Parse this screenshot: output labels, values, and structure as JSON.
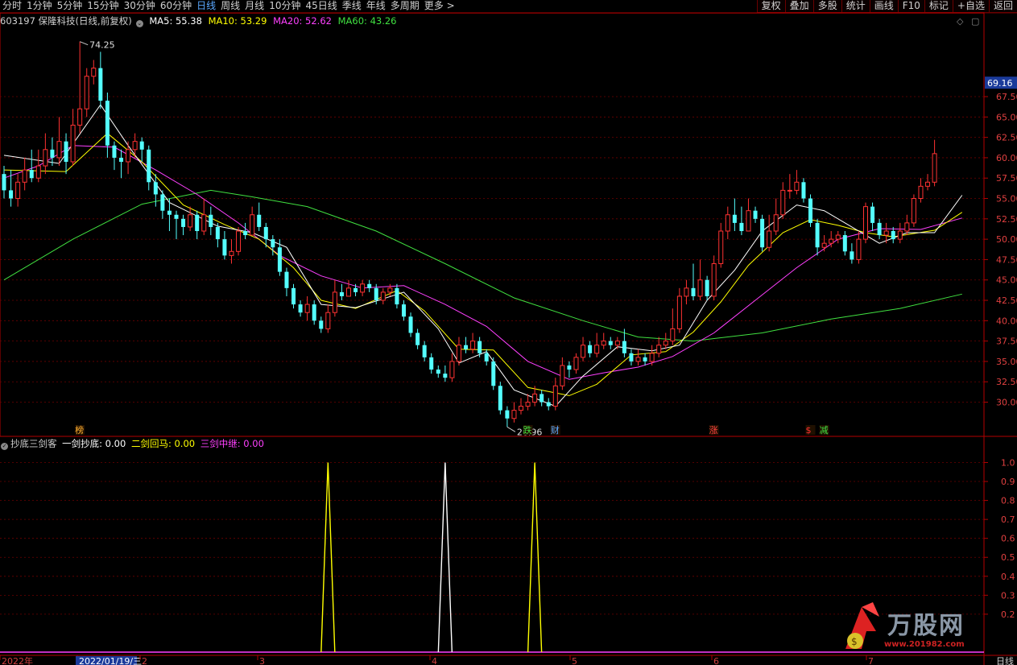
{
  "toolbar": {
    "periods": [
      "分时",
      "1分钟",
      "5分钟",
      "15分钟",
      "30分钟",
      "60分钟",
      "日线",
      "周线",
      "月线",
      "10分钟",
      "45日线",
      "季线",
      "年线",
      "多周期",
      "更多 >"
    ],
    "active_period": "日线",
    "tools": [
      "复权",
      "叠加",
      "多股",
      "统计",
      "画线",
      "F10",
      "标记",
      "+自选",
      "返回"
    ]
  },
  "info": {
    "stock": "603197 保隆科技(日线,前复权)",
    "ma5": "MA5: 55.38",
    "ma10": "MA10: 53.29",
    "ma20": "MA20: 52.62",
    "ma60": "MA60: 43.26"
  },
  "indicator": {
    "name": "抄底三剑客",
    "line1": "一剑抄底: 0.00",
    "line2": "二剑回马: 0.00",
    "line3": "三剑中继: 0.00"
  },
  "colors": {
    "up": "#ff3232",
    "down": "#54ffff",
    "ma5": "#ffffff",
    "ma10": "#ffff00",
    "ma20": "#ff40ff",
    "ma60": "#40e040",
    "axis": "#b40000",
    "grid": "#6e0000"
  },
  "chart_data": [
    {
      "type": "candlestick",
      "title": "",
      "ylim": [
        26.0,
        76.0
      ],
      "y_ticks": [
        "30.00",
        "32.50",
        "35.00",
        "37.50",
        "40.00",
        "42.50",
        "45.00",
        "47.50",
        "50.00",
        "52.50",
        "55.00",
        "57.50",
        "60.00",
        "62.50",
        "65.00",
        "67.50"
      ],
      "price_label": "69.16",
      "high_label": "74.25",
      "low_label": "26.96",
      "x_labels": [
        "2022年",
        "2022/01/19/三",
        "2",
        "3",
        "4",
        "5",
        "6",
        "7",
        "日线"
      ],
      "event_markers": [
        "榜",
        "跌",
        "财",
        "涨",
        "$",
        "减"
      ],
      "candles": [
        [
          58.0,
          56,
          59,
          55
        ],
        [
          56,
          55,
          58.5,
          54
        ],
        [
          55,
          57,
          58,
          54
        ],
        [
          57,
          58.5,
          60,
          56
        ],
        [
          58.5,
          57.5,
          61,
          57
        ],
        [
          57.5,
          59,
          61,
          57
        ],
        [
          59,
          61,
          63,
          58
        ],
        [
          61,
          60,
          62.5,
          59
        ],
        [
          60,
          62,
          65,
          59
        ],
        [
          62,
          59.5,
          63,
          58
        ],
        [
          59.5,
          64,
          66,
          59
        ],
        [
          64,
          66,
          74.25,
          63
        ],
        [
          66,
          70,
          71,
          65
        ],
        [
          70,
          71,
          72,
          69
        ],
        [
          71,
          67,
          73,
          66
        ],
        [
          67,
          61.5,
          68,
          60
        ],
        [
          61.5,
          60,
          62,
          58.5
        ],
        [
          60,
          59.5,
          61,
          57.5
        ],
        [
          59.5,
          61,
          62,
          58
        ],
        [
          61,
          62,
          63,
          60
        ],
        [
          62,
          61,
          62.5,
          59.5
        ],
        [
          61,
          57,
          61.5,
          56
        ],
        [
          57,
          55.5,
          58,
          54
        ],
        [
          55.5,
          53.5,
          56,
          52.5
        ],
        [
          53.5,
          53,
          55,
          51
        ],
        [
          53,
          52.5,
          53.5,
          50
        ],
        [
          52.5,
          51.5,
          53,
          50.5
        ],
        [
          51.5,
          53,
          54,
          51
        ],
        [
          53,
          51,
          53.5,
          50
        ],
        [
          51,
          53,
          55,
          50.5
        ],
        [
          53,
          51.5,
          54,
          50.5
        ],
        [
          51.5,
          50,
          52,
          49
        ],
        [
          50,
          48,
          51,
          47.5
        ],
        [
          48,
          48.5,
          50,
          47
        ],
        [
          48.5,
          51,
          51.5,
          48
        ],
        [
          51,
          50.5,
          52,
          50
        ],
        [
          50.5,
          53,
          54,
          50.5
        ],
        [
          53,
          51.5,
          54.5,
          51
        ],
        [
          51.5,
          50,
          52,
          49
        ],
        [
          50,
          49,
          50.5,
          48
        ],
        [
          49,
          46,
          50,
          45.5
        ],
        [
          46,
          44,
          46.5,
          43
        ],
        [
          44,
          42,
          44.5,
          41.5
        ],
        [
          42,
          41,
          42.5,
          40.5
        ],
        [
          41,
          42,
          43,
          40
        ],
        [
          42,
          40,
          42.5,
          39.5
        ],
        [
          40,
          39,
          40.5,
          38.5
        ],
        [
          39,
          41,
          42,
          38.5
        ],
        [
          41,
          43.5,
          45,
          40.5
        ],
        [
          43.5,
          43,
          44.5,
          42.5
        ],
        [
          43,
          44,
          45,
          43
        ],
        [
          44,
          43.5,
          44.5,
          43
        ],
        [
          43.5,
          44.5,
          45,
          43
        ],
        [
          44.5,
          44,
          45,
          43.5
        ],
        [
          44,
          42.5,
          44.5,
          42
        ],
        [
          42.5,
          43.5,
          44,
          42
        ],
        [
          43.5,
          44,
          44.5,
          43
        ],
        [
          44,
          42,
          44.5,
          41.5
        ],
        [
          42,
          40.5,
          42.5,
          40
        ],
        [
          40.5,
          38.5,
          41,
          38
        ],
        [
          38.5,
          37,
          39,
          36.5
        ],
        [
          37,
          35.5,
          37.5,
          35
        ],
        [
          35.5,
          34,
          36,
          33.5
        ],
        [
          34,
          33.5,
          34.5,
          33
        ],
        [
          33.5,
          33,
          34.5,
          32.5
        ],
        [
          33,
          35,
          36,
          32.5
        ],
        [
          35,
          37,
          38,
          34.5
        ],
        [
          37,
          36.5,
          38,
          36
        ],
        [
          36.5,
          37.5,
          38.5,
          36
        ],
        [
          37.5,
          36,
          38,
          35.5
        ],
        [
          36,
          35,
          36.5,
          34.5
        ],
        [
          35,
          32,
          35.5,
          31.5
        ],
        [
          32,
          29,
          32.5,
          28.5
        ],
        [
          29,
          28,
          29.5,
          26.96
        ],
        [
          28,
          29,
          30,
          27.5
        ],
        [
          29,
          29.5,
          30.5,
          28.5
        ],
        [
          29.5,
          30,
          31,
          29
        ],
        [
          30,
          31,
          32,
          29.5
        ],
        [
          31,
          30,
          31.5,
          29.5
        ],
        [
          30,
          29.5,
          30.5,
          29
        ],
        [
          29.5,
          32,
          33,
          29
        ],
        [
          32,
          34.5,
          35.5,
          31.5
        ],
        [
          34.5,
          34,
          35,
          33
        ],
        [
          34,
          35.5,
          36,
          33.5
        ],
        [
          35.5,
          37,
          38,
          35
        ],
        [
          37,
          36,
          37.5,
          35.5
        ],
        [
          36,
          37,
          38.5,
          35.5
        ],
        [
          37,
          37.5,
          38.5,
          36.5
        ],
        [
          37.5,
          37,
          38,
          36.5
        ],
        [
          37,
          37.5,
          38,
          36.5
        ],
        [
          37.5,
          36,
          39,
          35.5
        ],
        [
          36,
          35,
          36.5,
          34.5
        ],
        [
          35,
          35.5,
          36.5,
          34.5
        ],
        [
          35.5,
          35,
          36,
          34.5
        ],
        [
          35,
          36,
          37,
          34.5
        ],
        [
          36,
          37,
          38,
          35.5
        ],
        [
          37,
          37.5,
          38.5,
          36.5
        ],
        [
          37.5,
          39,
          41.5,
          37
        ],
        [
          39,
          43,
          44,
          38.5
        ],
        [
          43,
          44,
          45,
          42
        ],
        [
          44,
          43,
          47,
          42.5
        ],
        [
          43,
          45,
          47.5,
          42.5
        ],
        [
          45,
          43,
          45.5,
          42.5
        ],
        [
          43,
          47,
          48,
          42.5
        ],
        [
          47,
          51,
          52,
          46.5
        ],
        [
          51,
          53,
          54,
          50
        ],
        [
          53,
          52,
          55,
          51
        ],
        [
          52,
          51,
          54,
          50.5
        ],
        [
          51,
          53.5,
          55,
          51
        ],
        [
          53.5,
          52.5,
          54,
          52
        ],
        [
          52.5,
          49,
          53,
          48.5
        ],
        [
          49,
          51,
          53,
          48.5
        ],
        [
          51,
          53,
          55,
          50.5
        ],
        [
          53,
          56,
          57,
          52.5
        ],
        [
          56,
          56,
          58,
          55
        ],
        [
          56,
          57,
          58.5,
          55.5
        ],
        [
          57,
          55,
          57.5,
          54.5
        ],
        [
          55,
          52,
          55.5,
          51.5
        ],
        [
          52,
          49,
          52.5,
          48
        ],
        [
          49,
          49.5,
          50.5,
          48.5
        ],
        [
          49.5,
          50,
          51,
          49
        ],
        [
          50,
          50.5,
          51,
          49.5
        ],
        [
          50.5,
          48.5,
          51,
          48
        ],
        [
          48.5,
          47.5,
          49.5,
          47
        ],
        [
          47.5,
          50,
          51,
          47
        ],
        [
          50,
          54,
          54.5,
          49.5
        ],
        [
          54,
          52,
          54.5,
          51
        ],
        [
          52,
          50.5,
          52.5,
          50
        ],
        [
          50.5,
          51,
          52,
          49.5
        ],
        [
          51,
          50,
          51.5,
          49.5
        ],
        [
          50,
          51,
          52,
          49.5
        ],
        [
          51,
          52,
          53,
          50.5
        ],
        [
          52,
          55,
          55.5,
          51.5
        ],
        [
          55,
          56.5,
          57.5,
          54.5
        ],
        [
          56.5,
          57,
          58,
          56
        ],
        [
          57,
          60.5,
          62.2,
          56.5
        ]
      ],
      "ma": {
        "ma5": [
          [
            0,
            60.3
          ],
          [
            8,
            59.3
          ],
          [
            14,
            66.5
          ],
          [
            18,
            61.5
          ],
          [
            24,
            54.5
          ],
          [
            31,
            51.6
          ],
          [
            36,
            50.8
          ],
          [
            41,
            49.0
          ],
          [
            46,
            42.0
          ],
          [
            51,
            41.6
          ],
          [
            58,
            43.5
          ],
          [
            63,
            39.0
          ],
          [
            66,
            34.8
          ],
          [
            70,
            36.2
          ],
          [
            74,
            31.5
          ],
          [
            80,
            29.5
          ],
          [
            84,
            33.2
          ],
          [
            89,
            36.8
          ],
          [
            94,
            36.3
          ],
          [
            98,
            37.0
          ],
          [
            102,
            42.5
          ],
          [
            106,
            46.2
          ],
          [
            110,
            51.0
          ],
          [
            115,
            54.2
          ],
          [
            119,
            53.5
          ],
          [
            123,
            51.5
          ],
          [
            127,
            49.5
          ],
          [
            131,
            50.8
          ],
          [
            135,
            50.8
          ],
          [
            139,
            55.4
          ]
        ],
        "ma10": [
          [
            0,
            58.5
          ],
          [
            9,
            58.3
          ],
          [
            15,
            63.0
          ],
          [
            20,
            59.5
          ],
          [
            26,
            54.2
          ],
          [
            32,
            51.8
          ],
          [
            37,
            50.0
          ],
          [
            42,
            46.5
          ],
          [
            46,
            42.5
          ],
          [
            51,
            41.5
          ],
          [
            57,
            43.7
          ],
          [
            61,
            41.2
          ],
          [
            66,
            36.5
          ],
          [
            71,
            36.4
          ],
          [
            76,
            31.8
          ],
          [
            82,
            30.8
          ],
          [
            86,
            32.2
          ],
          [
            91,
            35.8
          ],
          [
            96,
            36.2
          ],
          [
            100,
            38.6
          ],
          [
            104,
            42.3
          ],
          [
            108,
            46.8
          ],
          [
            113,
            50.8
          ],
          [
            117,
            52.4
          ],
          [
            121,
            51.7
          ],
          [
            125,
            50.8
          ],
          [
            129,
            50.3
          ],
          [
            135,
            51.1
          ],
          [
            139,
            53.3
          ]
        ],
        "ma20": [
          [
            0,
            57.5
          ],
          [
            5,
            59.0
          ],
          [
            10,
            61.5
          ],
          [
            16,
            61.3
          ],
          [
            22,
            58.5
          ],
          [
            28,
            55.5
          ],
          [
            34,
            52.0
          ],
          [
            40,
            48.0
          ],
          [
            46,
            45.5
          ],
          [
            52,
            44.0
          ],
          [
            58,
            44.3
          ],
          [
            64,
            42.0
          ],
          [
            70,
            39.3
          ],
          [
            76,
            35.0
          ],
          [
            82,
            32.8
          ],
          [
            87,
            33.6
          ],
          [
            92,
            34.3
          ],
          [
            97,
            35.6
          ],
          [
            103,
            38.5
          ],
          [
            109,
            42.5
          ],
          [
            115,
            46.5
          ],
          [
            121,
            50.0
          ],
          [
            127,
            51.3
          ],
          [
            133,
            51.2
          ],
          [
            139,
            52.6
          ]
        ],
        "ma60": [
          [
            0,
            45.0
          ],
          [
            10,
            50.0
          ],
          [
            20,
            54.3
          ],
          [
            30,
            56.0
          ],
          [
            36,
            55.2
          ],
          [
            44,
            54.0
          ],
          [
            54,
            51.0
          ],
          [
            64,
            47.0
          ],
          [
            74,
            42.8
          ],
          [
            84,
            40.0
          ],
          [
            92,
            38.0
          ],
          [
            100,
            37.5
          ],
          [
            110,
            38.5
          ],
          [
            120,
            40.2
          ],
          [
            130,
            41.5
          ],
          [
            139,
            43.26
          ]
        ]
      }
    },
    {
      "type": "line",
      "title": "",
      "ylim": [
        0,
        1.07
      ],
      "y_ticks": [
        "0.2",
        "0.3",
        "0.4",
        "0.5",
        "0.6",
        "0.7",
        "0.8",
        "0.9",
        "1.0"
      ],
      "spikes": [
        {
          "index": 47,
          "value": 1.0,
          "series": "二剑回马"
        },
        {
          "index": 64,
          "value": 1.0,
          "series": "一剑抄底"
        },
        {
          "index": 77,
          "value": 1.0,
          "series": "二剑回马"
        }
      ]
    }
  ],
  "watermark": {
    "brand": "万股网",
    "url": "www.201982.com"
  }
}
